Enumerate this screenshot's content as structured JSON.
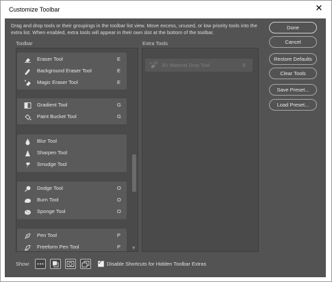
{
  "window": {
    "title": "Customize Toolbar"
  },
  "description": "Drag and drop tools or their groupings in the toolbar list view. Move excess, unused, or low priority tools into the extra list. When enabled, extra tools will appear in their own slot at the bottom of the toolbar.",
  "toolbar_panel": {
    "label": "Toolbar",
    "groups": [
      {
        "tools": [
          {
            "name": "Eraser Tool",
            "shortcut": "E",
            "icon": "eraser-icon"
          },
          {
            "name": "Background Eraser Tool",
            "shortcut": "E",
            "icon": "background-eraser-icon"
          },
          {
            "name": "Magic Eraser Tool",
            "shortcut": "E",
            "icon": "magic-eraser-icon"
          }
        ]
      },
      {
        "tools": [
          {
            "name": "Gradient Tool",
            "shortcut": "G",
            "icon": "gradient-icon"
          },
          {
            "name": "Paint Bucket Tool",
            "shortcut": "G",
            "icon": "paint-bucket-icon"
          }
        ]
      },
      {
        "tools": [
          {
            "name": "Blur Tool",
            "shortcut": "",
            "icon": "blur-icon"
          },
          {
            "name": "Sharpen Tool",
            "shortcut": "",
            "icon": "sharpen-icon"
          },
          {
            "name": "Smudge Tool",
            "shortcut": "",
            "icon": "smudge-icon"
          }
        ]
      },
      {
        "tools": [
          {
            "name": "Dodge Tool",
            "shortcut": "O",
            "icon": "dodge-icon"
          },
          {
            "name": "Burn Tool",
            "shortcut": "O",
            "icon": "burn-icon"
          },
          {
            "name": "Sponge Tool",
            "shortcut": "O",
            "icon": "sponge-icon"
          }
        ]
      },
      {
        "tools": [
          {
            "name": "Pen Tool",
            "shortcut": "P",
            "icon": "pen-icon"
          },
          {
            "name": "Freeform Pen Tool",
            "shortcut": "P",
            "icon": "freeform-pen-icon"
          }
        ]
      }
    ]
  },
  "extra_panel": {
    "label": "Extra Tools",
    "items": [
      {
        "name": "3D Material Drop Tool",
        "shortcut": "B",
        "icon": "3d-material-drop-icon"
      }
    ]
  },
  "buttons": {
    "done": "Done",
    "cancel": "Cancel",
    "restore_defaults": "Restore Defaults",
    "clear_tools": "Clear Tools",
    "save_preset": "Save Preset...",
    "load_preset": "Load Preset..."
  },
  "footer": {
    "show_label": "Show:",
    "show_buttons": [
      "more-options-icon",
      "foreground-background-icon",
      "quick-mask-icon",
      "screen-mode-icon"
    ],
    "checkbox_label": "Disable Shortcuts for Hidden Toolbar Extras",
    "checkbox_checked": true
  }
}
